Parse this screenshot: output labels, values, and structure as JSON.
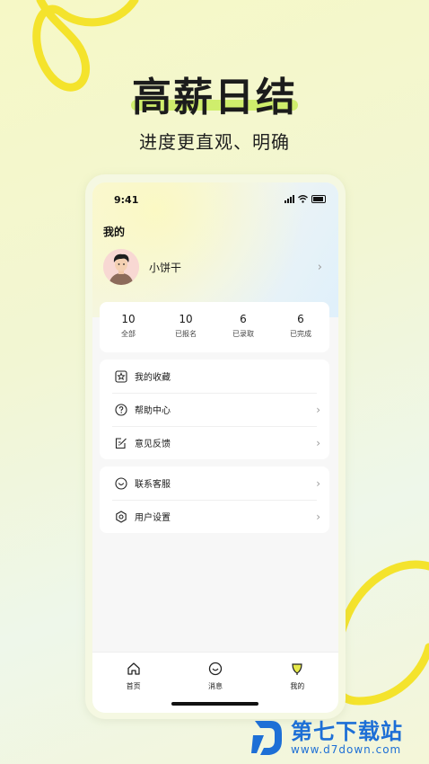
{
  "hero": {
    "title": "高薪日结",
    "subtitle": "进度更直观、明确"
  },
  "status_bar": {
    "time": "9:41"
  },
  "profile": {
    "page_title": "我的",
    "username": "小饼干"
  },
  "stats": [
    {
      "value": "10",
      "label": "全部"
    },
    {
      "value": "10",
      "label": "已报名"
    },
    {
      "value": "6",
      "label": "已录取"
    },
    {
      "value": "6",
      "label": "已完成"
    }
  ],
  "menu_group_1": [
    {
      "label": "我的收藏",
      "icon": "star-box-icon",
      "chevron": false
    },
    {
      "label": "帮助中心",
      "icon": "question-circle-icon",
      "chevron": true
    },
    {
      "label": "意见反馈",
      "icon": "feedback-edit-icon",
      "chevron": true
    }
  ],
  "menu_group_2": [
    {
      "label": "联系客服",
      "icon": "smile-heart-icon",
      "chevron": true
    },
    {
      "label": "用户设置",
      "icon": "settings-hex-icon",
      "chevron": true
    }
  ],
  "tabs": [
    {
      "label": "首页",
      "icon": "home-icon"
    },
    {
      "label": "消息",
      "icon": "message-smile-icon"
    },
    {
      "label": "我的",
      "icon": "profile-leaf-icon",
      "active": true
    }
  ],
  "watermark": {
    "title": "第七下载站",
    "url": "www.d7down.com"
  },
  "colors": {
    "accent_yellow": "#f7e12a",
    "accent_green": "#c8ec5a",
    "watermark_blue": "#1d6fd6"
  }
}
